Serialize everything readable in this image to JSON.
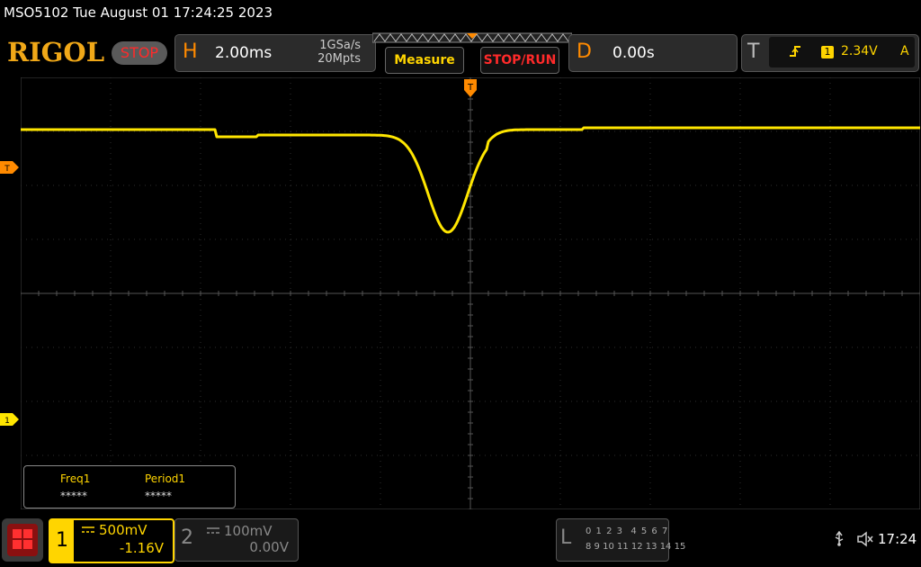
{
  "titlebar": {
    "text": "MSO5102  Tue August 01 17:24:25 2023"
  },
  "logo": {
    "text": "RIGOL"
  },
  "run_state": {
    "label": "STOP",
    "color": "#ff2a2a"
  },
  "horizontal": {
    "letter": "H",
    "timebase": "2.00ms",
    "sample_rate": "1GSa/s",
    "memory_depth": "20Mpts"
  },
  "buttons": {
    "measure": "Measure",
    "stop_run": "STOP/RUN"
  },
  "delay": {
    "letter": "D",
    "value": "0.00s"
  },
  "trigger": {
    "letter": "T",
    "edge_icon": "rising-edge-icon",
    "source_channel": "1",
    "level": "2.34V",
    "mode": "A"
  },
  "markers": {
    "trigger_position": "T",
    "trigger_level": "T",
    "ch1_ground": "1"
  },
  "measurements": [
    {
      "label": "Freq1",
      "value": "*****"
    },
    {
      "label": "Period1",
      "value": "*****"
    }
  ],
  "channel1": {
    "number": "1",
    "coupling_icon": "dc-coupling-icon",
    "scale": "500mV",
    "offset": "-1.16V",
    "color": "#ffd500"
  },
  "channel2": {
    "number": "2",
    "coupling_icon": "dc-coupling-icon",
    "scale": "100mV",
    "offset": "0.00V"
  },
  "logic": {
    "letter": "L",
    "row1": "0 1 2 3  4 5 6 7",
    "row2": "8 9 10 11 12 13 14 15"
  },
  "status": {
    "usb_icon": "usb-icon",
    "sound_icon": "speaker-muted-icon",
    "clock": "17:24"
  },
  "colors": {
    "trace": "#ffe600",
    "accent": "#ff8a00",
    "background": "#000000"
  },
  "waveform": {
    "baseline_div_from_top": 1.0,
    "dip_center_ms": -0.5,
    "dip_min_div_from_top": 2.8
  }
}
